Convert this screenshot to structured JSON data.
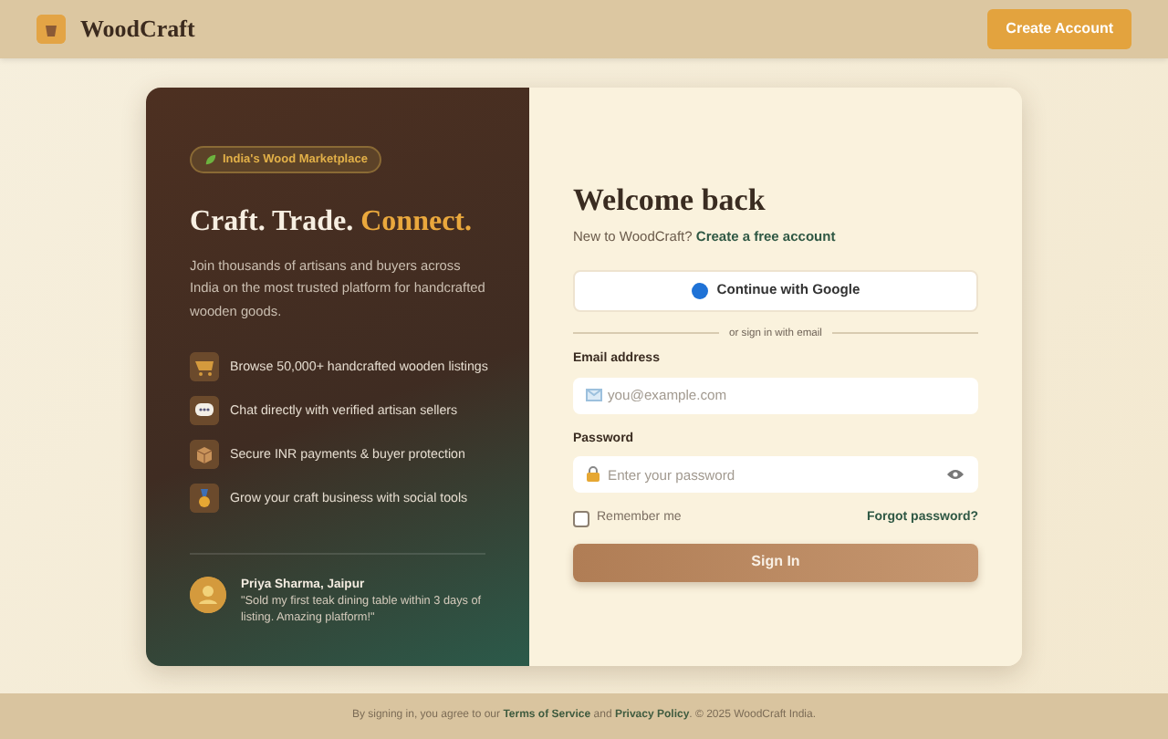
{
  "header": {
    "brand": "WoodCraft",
    "button": "Create Account"
  },
  "promo": {
    "badge": "India's Wood Marketplace",
    "title": "Craft. Trade.",
    "title_accent": "Connect.",
    "intro": "Join thousands of artisans and buyers across India on the most trusted platform for handcrafted wooden goods.",
    "features": [
      {
        "kind": "cart",
        "text": "Browse 50,000+ handcrafted wooden listings"
      },
      {
        "kind": "chat",
        "text": "Chat directly with verified artisan sellers"
      },
      {
        "kind": "box",
        "text": "Secure INR payments & buyer protection"
      },
      {
        "kind": "medal",
        "text": "Grow your craft business with social tools"
      }
    ],
    "testimonial": {
      "author": "Priya Sharma, Jaipur",
      "quote": "\"Sold my first teak dining table within 3 days of listing. Amazing platform!\""
    }
  },
  "login": {
    "title": "Welcome back",
    "subtitle": "New to WoodCraft?",
    "signup_link": "Create a free account",
    "google_button": "Continue with Google",
    "divider": "or sign in with email",
    "email_label": "Email address",
    "email_placeholder": "you@example.com",
    "password_label": "Password",
    "password_placeholder": "Enter your password",
    "remember": {
      "label": "Remember me",
      "checked": false
    },
    "forgot": "Forgot password?",
    "submit": "Sign In"
  },
  "footer": {
    "prefix": "By signing in, you agree to our",
    "terms": "Terms of Service",
    "middle": "and",
    "privacy": "Privacy Policy",
    "suffix": ". © 2025 WoodCraft India."
  }
}
